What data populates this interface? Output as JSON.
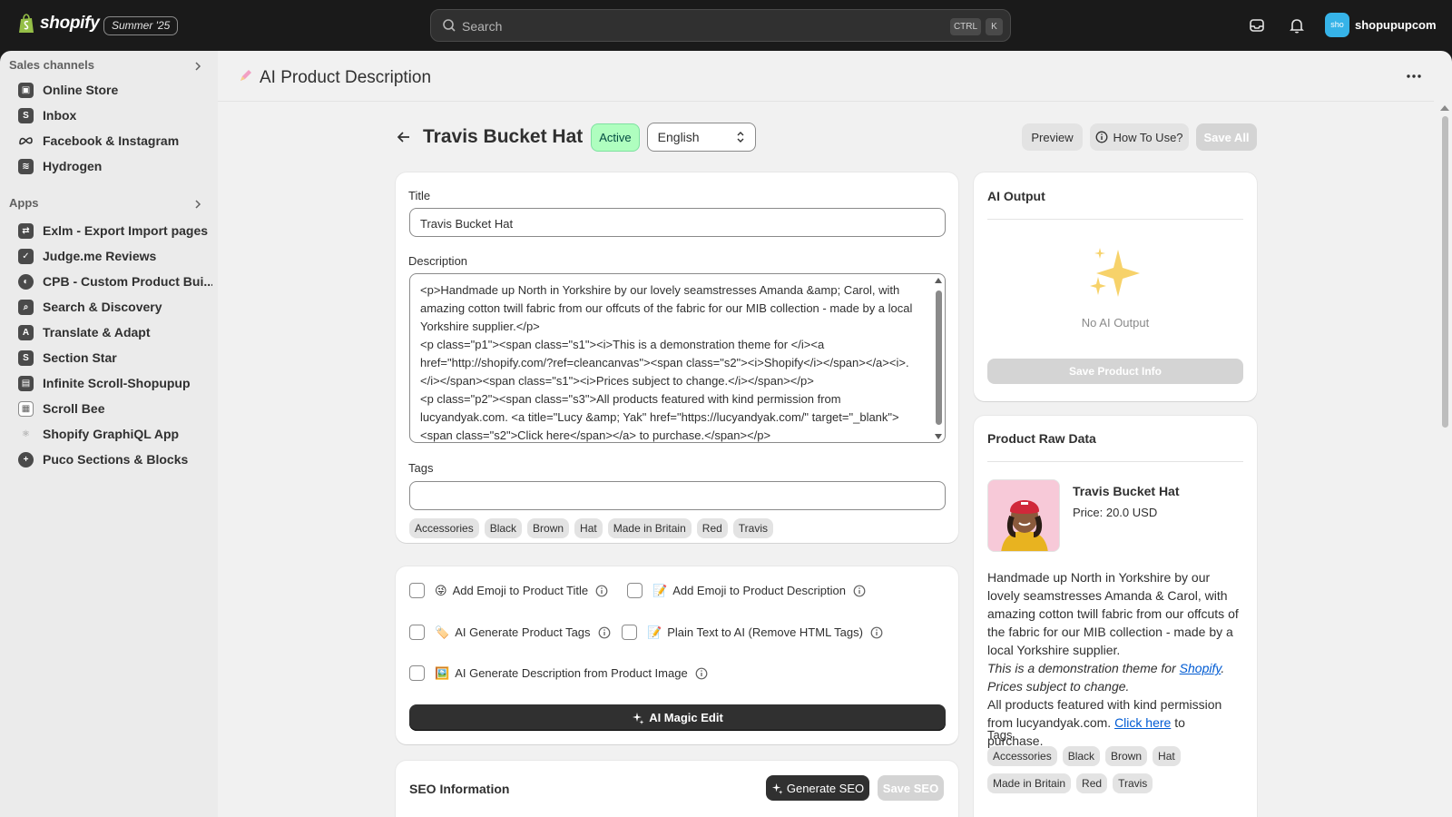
{
  "topbar": {
    "logo_text": "shopify",
    "edition_badge": "Summer '25",
    "search_placeholder": "Search",
    "shortcut_ctrl": "CTRL",
    "shortcut_k": "K",
    "user_avatar_text": "sho",
    "user_name": "shopupupcom"
  },
  "sidebar": {
    "sales_channels_label": "Sales channels",
    "sales_channels": [
      {
        "label": "Online Store",
        "icon": "store-icon"
      },
      {
        "label": "Inbox",
        "icon": "inbox-icon"
      },
      {
        "label": "Facebook & Instagram",
        "icon": "meta-icon"
      },
      {
        "label": "Hydrogen",
        "icon": "hydrogen-icon"
      }
    ],
    "apps_label": "Apps",
    "apps": [
      {
        "label": "Exlm - Export Import pages",
        "icon": "exlm-icon"
      },
      {
        "label": "Judge.me Reviews",
        "icon": "judgeme-icon"
      },
      {
        "label": "CPB - Custom Product Bui...",
        "icon": "cpb-icon"
      },
      {
        "label": "Search & Discovery",
        "icon": "search-discovery-icon"
      },
      {
        "label": "Translate & Adapt",
        "icon": "translate-icon"
      },
      {
        "label": "Section Star",
        "icon": "section-star-icon"
      },
      {
        "label": "Infinite Scroll-Shopupup",
        "icon": "infinite-scroll-icon"
      },
      {
        "label": "Scroll Bee",
        "icon": "scroll-bee-icon"
      },
      {
        "label": "Shopify GraphiQL App",
        "icon": "graphiql-icon"
      },
      {
        "label": "Puco Sections & Blocks",
        "icon": "puco-icon"
      }
    ]
  },
  "app_header": {
    "title": "AI Product Description"
  },
  "product": {
    "name": "Travis Bucket Hat",
    "status": "Active",
    "language": "English"
  },
  "actions": {
    "preview": "Preview",
    "how_to_use": "How To Use?",
    "save_all": "Save All"
  },
  "form": {
    "title_label": "Title",
    "title_value": "Travis Bucket Hat",
    "description_label": "Description",
    "description_value": "<p>Handmade up North in Yorkshire by our lovely seamstresses Amanda &amp; Carol, with amazing cotton twill fabric from our offcuts of the fabric for our MIB collection - made by a local Yorkshire supplier.</p>\n<p class=\"p1\"><span class=\"s1\"><i>This is a demonstration theme for </i><a href=\"http://shopify.com/?ref=cleancanvas\"><span class=\"s2\"><i>Shopify</i></span></a><i>. </i></span><span class=\"s1\"><i>Prices subject to change.</i></span></p>\n<p class=\"p2\"><span class=\"s3\">All products featured with kind permission from lucyandyak.com. <a title=\"Lucy &amp; Yak\" href=\"https://lucyandyak.com/\" target=\"_blank\"><span class=\"s2\">Click here</span></a> to purchase.</span></p>",
    "tags_label": "Tags",
    "tags_value": "",
    "tags": [
      "Accessories",
      "Black",
      "Brown",
      "Hat",
      "Made in Britain",
      "Red",
      "Travis"
    ]
  },
  "options": [
    {
      "label": "Add Emoji to Product Title",
      "emoji": "😜"
    },
    {
      "label": "Add Emoji to Product Description",
      "emoji": "📝"
    },
    {
      "label": "AI Generate Product Tags",
      "emoji": "🏷️"
    },
    {
      "label": "Plain Text to AI (Remove HTML Tags)",
      "emoji": "📝"
    },
    {
      "label": "AI Generate Description from Product Image",
      "emoji": "🖼️"
    }
  ],
  "magic_edit_label": "AI Magic Edit",
  "seo": {
    "title": "SEO Information",
    "generate_label": "Generate SEO",
    "save_label": "Save SEO"
  },
  "ai_output": {
    "title": "AI Output",
    "empty_text": "No AI Output",
    "save_label": "Save Product Info"
  },
  "raw_data": {
    "title": "Product Raw Data",
    "product_name": "Travis Bucket Hat",
    "price": "Price: 20.0 USD",
    "desc_p1": "Handmade up North in Yorkshire by our lovely seamstresses Amanda & Carol, with amazing cotton twill fabric from our offcuts of the fabric for our MIB collection - made by a local Yorkshire supplier.",
    "desc_p2_a": "This is a demonstration theme for ",
    "desc_p2_link": "Shopify",
    "desc_p2_b": ". Prices subject to change.",
    "desc_p3_a": "All products featured with kind permission from lucyandyak.com. ",
    "desc_p3_link": "Click here",
    "desc_p3_b": " to purchase.",
    "tags_label": "Tags",
    "tags": [
      "Accessories",
      "Black",
      "Brown",
      "Hat",
      "Made in Britain",
      "Red",
      "Travis"
    ]
  },
  "colors": {
    "topbar_bg": "#1a1a1a",
    "sidebar_bg": "#ebebeb",
    "main_bg": "#f1f1f1",
    "active_badge": "#affebf",
    "primary_button": "#303030",
    "link": "#005bd3"
  }
}
